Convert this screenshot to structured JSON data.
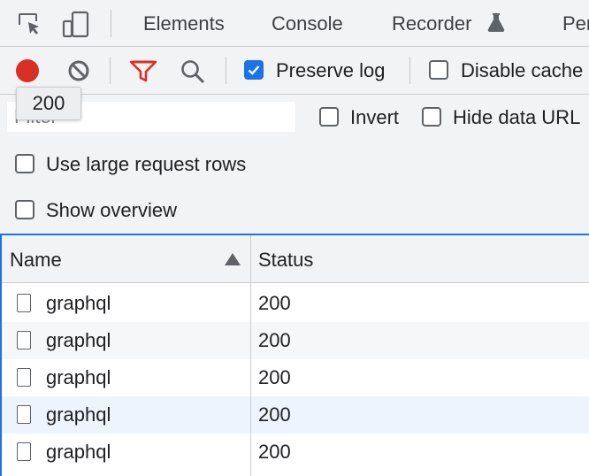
{
  "tabs": [
    {
      "label": "Elements"
    },
    {
      "label": "Console"
    },
    {
      "label": "Recorder"
    },
    {
      "label": "Per"
    }
  ],
  "toolbar": {
    "preserve_log": {
      "label": "Preserve log",
      "checked": true
    },
    "disable_cache": {
      "label": "Disable cache",
      "checked": false
    }
  },
  "tooltip": {
    "text": "200"
  },
  "filter": {
    "placeholder": "Filter",
    "value": ""
  },
  "filter_options": {
    "invert": {
      "label": "Invert",
      "checked": false
    },
    "hide_data_urls": {
      "label": "Hide data URL",
      "checked": false
    }
  },
  "options": {
    "large_rows": {
      "label": "Use large request rows",
      "checked": false
    },
    "overview": {
      "label": "Show overview",
      "checked": false
    }
  },
  "table": {
    "columns": {
      "name": "Name",
      "status": "Status"
    },
    "rows": [
      {
        "name": "graphql",
        "status": "200"
      },
      {
        "name": "graphql",
        "status": "200"
      },
      {
        "name": "graphql",
        "status": "200"
      },
      {
        "name": "graphql",
        "status": "200"
      },
      {
        "name": "graphql",
        "status": "200"
      }
    ]
  },
  "colors": {
    "record": "#d93025",
    "filter_icon": "#d93025",
    "accent": "#1a73e8",
    "row_alt": "#f6f7f8",
    "row_selected": "#eef4fd"
  }
}
